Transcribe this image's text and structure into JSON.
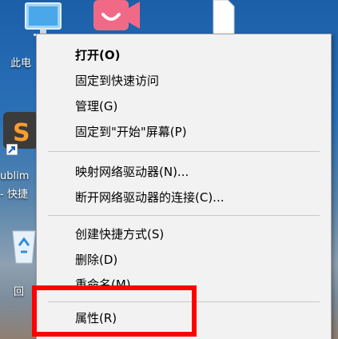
{
  "desktop": {
    "icons": [
      {
        "name": "this-pc",
        "label": "此电"
      },
      {
        "name": "sublime-shortcut",
        "label_line1": "ublim",
        "label_line2": "- 快捷"
      },
      {
        "name": "recycle-bin",
        "label": "回"
      }
    ]
  },
  "context_menu": {
    "items": [
      {
        "label": "打开(O)"
      },
      {
        "label": "固定到快速访问"
      },
      {
        "label": "管理(G)"
      },
      {
        "label": "固定到\"开始\"屏幕(P)"
      },
      {
        "label": "映射网络驱动器(N)..."
      },
      {
        "label": "断开网络驱动器的连接(C)..."
      },
      {
        "label": "创建快捷方式(S)"
      },
      {
        "label": "删除(D)"
      },
      {
        "label": "重命名(M)"
      },
      {
        "label": "属性(R)"
      }
    ]
  },
  "annotation": {
    "color": "#ff0000"
  }
}
